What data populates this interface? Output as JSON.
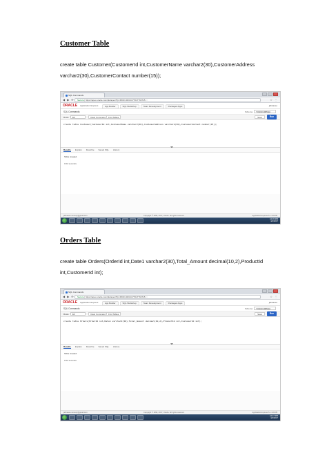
{
  "sections": [
    {
      "heading": "Customer Table",
      "code_lines": [
        "create table Customer(CustomerId int,CustomerName varchar2(30),CustomerAddress",
        "varchar2(30),CustomerContact number(15));"
      ],
      "screenshot": {
        "tab_title": "SQL Commands",
        "url_secure": "Secure",
        "url": "https://apex.oracle.com/pls/apex/f?p=4500:1003:1677047763715::::",
        "brand": "ORACLE",
        "product": "Application Express",
        "menus": [
          "App Builder",
          "SQL Workshop",
          "Team Development",
          "Packaged Apps"
        ],
        "user": "jahnavee",
        "page_title": "SQL Commands",
        "schema_label": "Schema",
        "schema_value": "YUSUF1995HA",
        "rows_label": "Rows",
        "rows_value": "10",
        "toolbar_buttons": [
          "Clear Command",
          "Find Tables"
        ],
        "save_label": "Save",
        "run_label": "Run",
        "sql": "create table Customer(CustomerId int,CustomerName varchar2(30),CustomerAddress varchar2(30),CustomerContact number(15));",
        "result_tabs": [
          "Results",
          "Explain",
          "Describe",
          "Saved SQL",
          "History"
        ],
        "result_line1": "Table created.",
        "result_line2": "0.02 seconds",
        "status_left": "jahnavee.mouncy@gmail.com",
        "status_mid": "Copyright © 1999, 2017, Oracle. All rights reserved.",
        "status_right": "Application Express 5.1.3.00.05",
        "clock_time": "10:45 PM",
        "clock_date": "4/4/2017"
      }
    },
    {
      "heading": "Orders Table",
      "code_lines": [
        "create table Orders(OrderId int,Date1 varchar2(30),Total_Amount decimal(10,2),ProductId",
        "int,CustomerId int);"
      ],
      "screenshot": {
        "tab_title": "SQL Commands",
        "url_secure": "Secure",
        "url": "https://apex.oracle.com/pls/apex/f?p=4500:1003:1677047763715::::",
        "brand": "ORACLE",
        "product": "Application Express",
        "menus": [
          "App Builder",
          "SQL Workshop",
          "Team Development",
          "Packaged Apps"
        ],
        "user": "jahnavee",
        "page_title": "SQL Commands",
        "schema_label": "Schema",
        "schema_value": "YUSUF1995HA",
        "rows_label": "Rows",
        "rows_value": "10",
        "toolbar_buttons": [
          "Clear Command",
          "Find Tables"
        ],
        "save_label": "Save",
        "run_label": "Run",
        "sql": "create table Orders(OrderId int,Date1 varchar2(30),Total_Amount decimal(10,2),ProductId int,CustomerId int);",
        "result_tabs": [
          "Results",
          "Explain",
          "Describe",
          "Saved SQL",
          "History"
        ],
        "result_line1": "Table created.",
        "result_line2": "0.02 seconds",
        "status_left": "jahnavee.mouncy@gmail.com",
        "status_mid": "Copyright © 1999, 2017, Oracle. All rights reserved.",
        "status_right": "Application Express 5.1.3.00.05",
        "clock_time": "10:47 PM",
        "clock_date": "4/4/2017"
      }
    }
  ]
}
